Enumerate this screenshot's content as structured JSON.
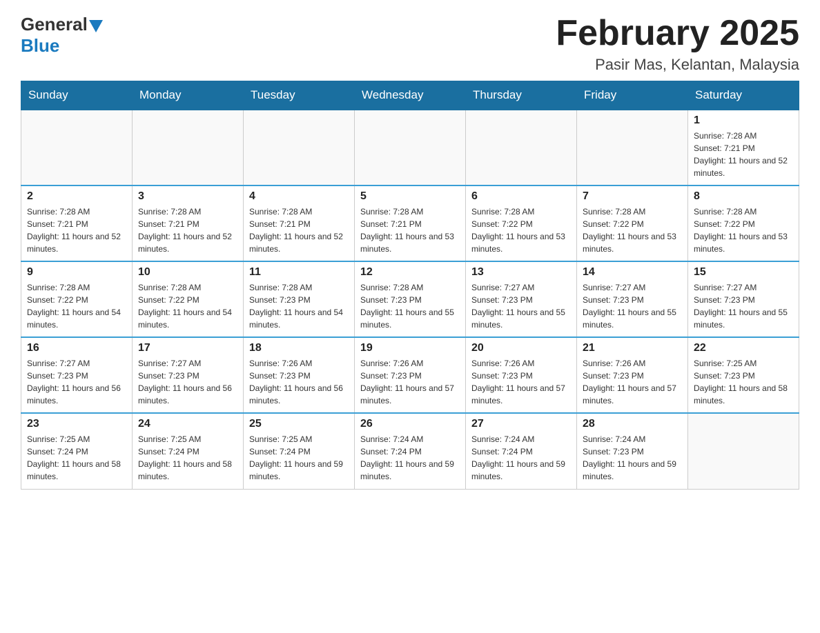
{
  "header": {
    "logo_general": "General",
    "logo_blue": "Blue",
    "main_title": "February 2025",
    "subtitle": "Pasir Mas, Kelantan, Malaysia"
  },
  "days_of_week": [
    "Sunday",
    "Monday",
    "Tuesday",
    "Wednesday",
    "Thursday",
    "Friday",
    "Saturday"
  ],
  "weeks": [
    [
      {
        "day": "",
        "info": ""
      },
      {
        "day": "",
        "info": ""
      },
      {
        "day": "",
        "info": ""
      },
      {
        "day": "",
        "info": ""
      },
      {
        "day": "",
        "info": ""
      },
      {
        "day": "",
        "info": ""
      },
      {
        "day": "1",
        "info": "Sunrise: 7:28 AM\nSunset: 7:21 PM\nDaylight: 11 hours and 52 minutes."
      }
    ],
    [
      {
        "day": "2",
        "info": "Sunrise: 7:28 AM\nSunset: 7:21 PM\nDaylight: 11 hours and 52 minutes."
      },
      {
        "day": "3",
        "info": "Sunrise: 7:28 AM\nSunset: 7:21 PM\nDaylight: 11 hours and 52 minutes."
      },
      {
        "day": "4",
        "info": "Sunrise: 7:28 AM\nSunset: 7:21 PM\nDaylight: 11 hours and 52 minutes."
      },
      {
        "day": "5",
        "info": "Sunrise: 7:28 AM\nSunset: 7:21 PM\nDaylight: 11 hours and 53 minutes."
      },
      {
        "day": "6",
        "info": "Sunrise: 7:28 AM\nSunset: 7:22 PM\nDaylight: 11 hours and 53 minutes."
      },
      {
        "day": "7",
        "info": "Sunrise: 7:28 AM\nSunset: 7:22 PM\nDaylight: 11 hours and 53 minutes."
      },
      {
        "day": "8",
        "info": "Sunrise: 7:28 AM\nSunset: 7:22 PM\nDaylight: 11 hours and 53 minutes."
      }
    ],
    [
      {
        "day": "9",
        "info": "Sunrise: 7:28 AM\nSunset: 7:22 PM\nDaylight: 11 hours and 54 minutes."
      },
      {
        "day": "10",
        "info": "Sunrise: 7:28 AM\nSunset: 7:22 PM\nDaylight: 11 hours and 54 minutes."
      },
      {
        "day": "11",
        "info": "Sunrise: 7:28 AM\nSunset: 7:23 PM\nDaylight: 11 hours and 54 minutes."
      },
      {
        "day": "12",
        "info": "Sunrise: 7:28 AM\nSunset: 7:23 PM\nDaylight: 11 hours and 55 minutes."
      },
      {
        "day": "13",
        "info": "Sunrise: 7:27 AM\nSunset: 7:23 PM\nDaylight: 11 hours and 55 minutes."
      },
      {
        "day": "14",
        "info": "Sunrise: 7:27 AM\nSunset: 7:23 PM\nDaylight: 11 hours and 55 minutes."
      },
      {
        "day": "15",
        "info": "Sunrise: 7:27 AM\nSunset: 7:23 PM\nDaylight: 11 hours and 55 minutes."
      }
    ],
    [
      {
        "day": "16",
        "info": "Sunrise: 7:27 AM\nSunset: 7:23 PM\nDaylight: 11 hours and 56 minutes."
      },
      {
        "day": "17",
        "info": "Sunrise: 7:27 AM\nSunset: 7:23 PM\nDaylight: 11 hours and 56 minutes."
      },
      {
        "day": "18",
        "info": "Sunrise: 7:26 AM\nSunset: 7:23 PM\nDaylight: 11 hours and 56 minutes."
      },
      {
        "day": "19",
        "info": "Sunrise: 7:26 AM\nSunset: 7:23 PM\nDaylight: 11 hours and 57 minutes."
      },
      {
        "day": "20",
        "info": "Sunrise: 7:26 AM\nSunset: 7:23 PM\nDaylight: 11 hours and 57 minutes."
      },
      {
        "day": "21",
        "info": "Sunrise: 7:26 AM\nSunset: 7:23 PM\nDaylight: 11 hours and 57 minutes."
      },
      {
        "day": "22",
        "info": "Sunrise: 7:25 AM\nSunset: 7:23 PM\nDaylight: 11 hours and 58 minutes."
      }
    ],
    [
      {
        "day": "23",
        "info": "Sunrise: 7:25 AM\nSunset: 7:24 PM\nDaylight: 11 hours and 58 minutes."
      },
      {
        "day": "24",
        "info": "Sunrise: 7:25 AM\nSunset: 7:24 PM\nDaylight: 11 hours and 58 minutes."
      },
      {
        "day": "25",
        "info": "Sunrise: 7:25 AM\nSunset: 7:24 PM\nDaylight: 11 hours and 59 minutes."
      },
      {
        "day": "26",
        "info": "Sunrise: 7:24 AM\nSunset: 7:24 PM\nDaylight: 11 hours and 59 minutes."
      },
      {
        "day": "27",
        "info": "Sunrise: 7:24 AM\nSunset: 7:24 PM\nDaylight: 11 hours and 59 minutes."
      },
      {
        "day": "28",
        "info": "Sunrise: 7:24 AM\nSunset: 7:23 PM\nDaylight: 11 hours and 59 minutes."
      },
      {
        "day": "",
        "info": ""
      }
    ]
  ]
}
